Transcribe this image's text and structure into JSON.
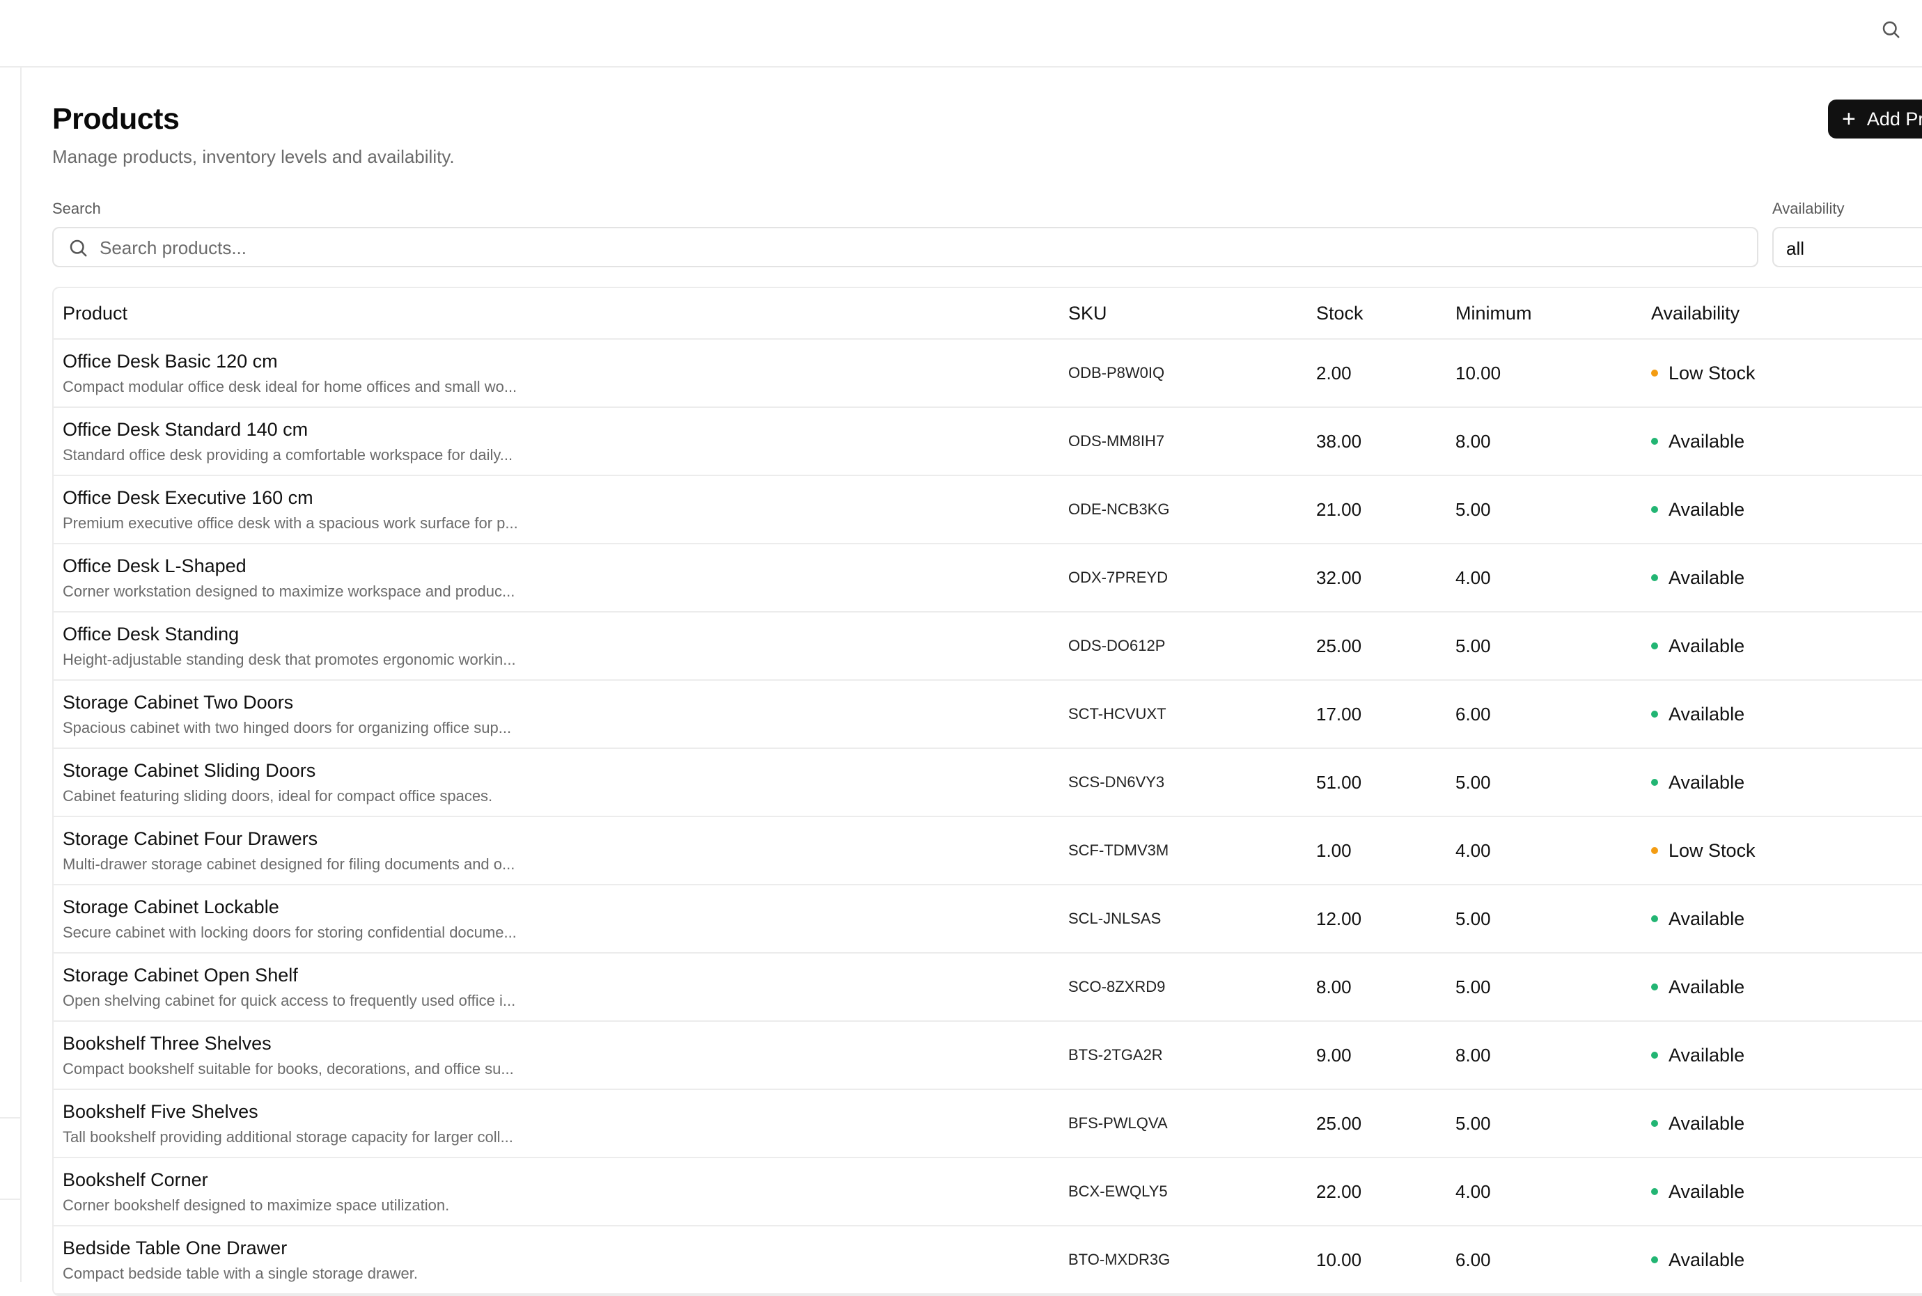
{
  "header": {
    "search_icon": "search-icon"
  },
  "page": {
    "title": "Products",
    "subtitle": "Manage products, inventory levels and availability.",
    "add_button_label": "Add Pr"
  },
  "filters": {
    "search_label": "Search",
    "search_placeholder": "Search products...",
    "search_value": "",
    "availability_label": "Availability",
    "availability_value": "all"
  },
  "table": {
    "columns": [
      "Product",
      "SKU",
      "Stock",
      "Minimum",
      "Availability"
    ],
    "rows": [
      {
        "name": "Office Desk Basic 120 cm",
        "description": "Compact modular office desk ideal for home offices and small wo...",
        "sku": "ODB-P8W0IQ",
        "stock": "2.00",
        "minimum": "10.00",
        "availability": "Low Stock",
        "status": "low"
      },
      {
        "name": "Office Desk Standard 140 cm",
        "description": "Standard office desk providing a comfortable workspace for daily...",
        "sku": "ODS-MM8IH7",
        "stock": "38.00",
        "minimum": "8.00",
        "availability": "Available",
        "status": "ok"
      },
      {
        "name": "Office Desk Executive 160 cm",
        "description": "Premium executive office desk with a spacious work surface for p...",
        "sku": "ODE-NCB3KG",
        "stock": "21.00",
        "minimum": "5.00",
        "availability": "Available",
        "status": "ok"
      },
      {
        "name": "Office Desk L-Shaped",
        "description": "Corner workstation designed to maximize workspace and produc...",
        "sku": "ODX-7PREYD",
        "stock": "32.00",
        "minimum": "4.00",
        "availability": "Available",
        "status": "ok"
      },
      {
        "name": "Office Desk Standing",
        "description": "Height-adjustable standing desk that promotes ergonomic workin...",
        "sku": "ODS-DO612P",
        "stock": "25.00",
        "minimum": "5.00",
        "availability": "Available",
        "status": "ok"
      },
      {
        "name": "Storage Cabinet Two Doors",
        "description": "Spacious cabinet with two hinged doors for organizing office sup...",
        "sku": "SCT-HCVUXT",
        "stock": "17.00",
        "minimum": "6.00",
        "availability": "Available",
        "status": "ok"
      },
      {
        "name": "Storage Cabinet Sliding Doors",
        "description": "Cabinet featuring sliding doors, ideal for compact office spaces.",
        "sku": "SCS-DN6VY3",
        "stock": "51.00",
        "minimum": "5.00",
        "availability": "Available",
        "status": "ok"
      },
      {
        "name": "Storage Cabinet Four Drawers",
        "description": "Multi-drawer storage cabinet designed for filing documents and o...",
        "sku": "SCF-TDMV3M",
        "stock": "1.00",
        "minimum": "4.00",
        "availability": "Low Stock",
        "status": "low"
      },
      {
        "name": "Storage Cabinet Lockable",
        "description": "Secure cabinet with locking doors for storing confidential docume...",
        "sku": "SCL-JNLSAS",
        "stock": "12.00",
        "minimum": "5.00",
        "availability": "Available",
        "status": "ok"
      },
      {
        "name": "Storage Cabinet Open Shelf",
        "description": "Open shelving cabinet for quick access to frequently used office i...",
        "sku": "SCO-8ZXRD9",
        "stock": "8.00",
        "minimum": "5.00",
        "availability": "Available",
        "status": "ok"
      },
      {
        "name": "Bookshelf Three Shelves",
        "description": "Compact bookshelf suitable for books, decorations, and office su...",
        "sku": "BTS-2TGA2R",
        "stock": "9.00",
        "minimum": "8.00",
        "availability": "Available",
        "status": "ok"
      },
      {
        "name": "Bookshelf Five Shelves",
        "description": "Tall bookshelf providing additional storage capacity for larger coll...",
        "sku": "BFS-PWLQVA",
        "stock": "25.00",
        "minimum": "5.00",
        "availability": "Available",
        "status": "ok"
      },
      {
        "name": "Bookshelf Corner",
        "description": "Corner bookshelf designed to maximize space utilization.",
        "sku": "BCX-EWQLY5",
        "stock": "22.00",
        "minimum": "4.00",
        "availability": "Available",
        "status": "ok"
      },
      {
        "name": "Bedside Table One Drawer",
        "description": "Compact bedside table with a single storage drawer.",
        "sku": "BTO-MXDR3G",
        "stock": "10.00",
        "minimum": "6.00",
        "availability": "Available",
        "status": "ok"
      }
    ]
  },
  "colors": {
    "available": "#22b573",
    "low_stock": "#f39c12",
    "button": "#111111",
    "border": "#ececec"
  }
}
